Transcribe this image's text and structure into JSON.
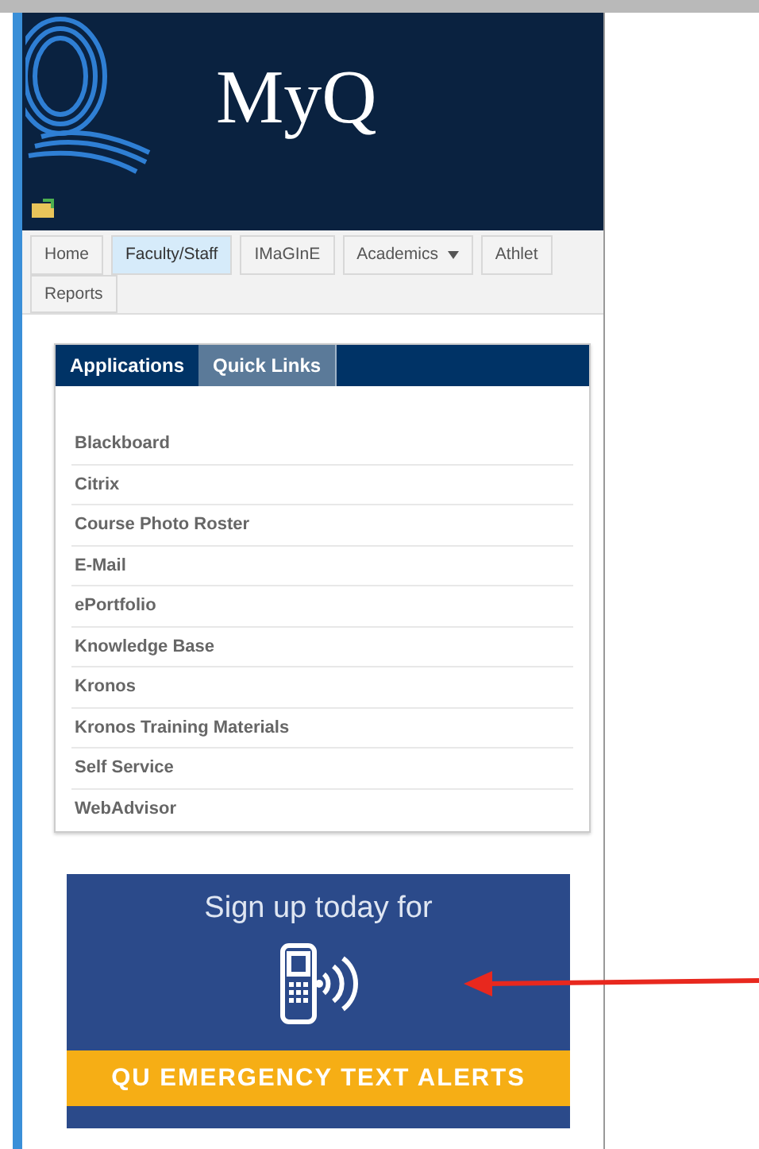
{
  "header": {
    "title": "MyQ"
  },
  "nav": [
    {
      "label": "Home",
      "selected": false,
      "dropdown": false
    },
    {
      "label": "Faculty/Staff",
      "selected": true,
      "dropdown": false
    },
    {
      "label": "IMaGInE",
      "selected": false,
      "dropdown": false
    },
    {
      "label": "Academics",
      "selected": false,
      "dropdown": true
    },
    {
      "label": "Athlet",
      "selected": false,
      "dropdown": false
    },
    {
      "label": "Reports",
      "selected": false,
      "dropdown": false
    }
  ],
  "panel": {
    "tabs": [
      {
        "label": "Applications",
        "selected": true
      },
      {
        "label": "Quick Links",
        "selected": false
      }
    ],
    "links": [
      "Blackboard",
      "Citrix",
      "Course Photo Roster",
      "E-Mail",
      "ePortfolio",
      "Knowledge Base",
      "Kronos",
      "Kronos Training Materials",
      "Self Service",
      "WebAdvisor"
    ]
  },
  "banner": {
    "heading": "Sign up today for",
    "strip": "QU EMERGENCY TEXT ALERTS"
  }
}
